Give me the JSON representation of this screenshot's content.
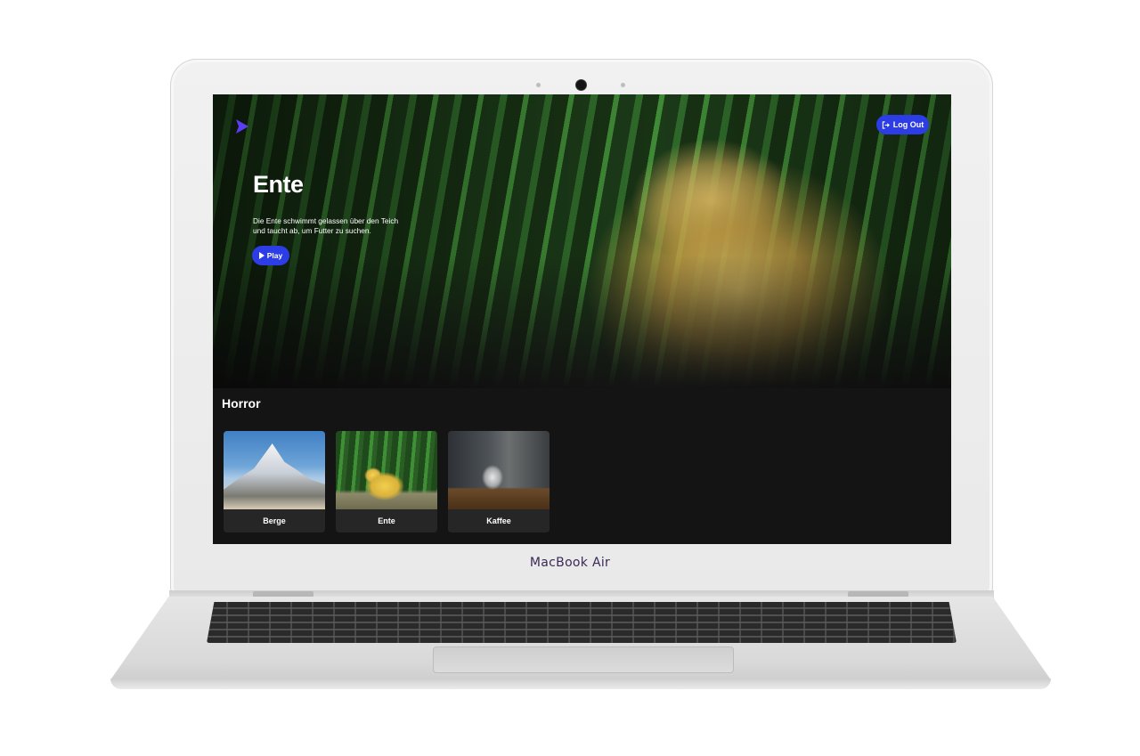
{
  "device": {
    "brand": "MacBook Air"
  },
  "app": {
    "logout_label": "Log Out",
    "hero": {
      "title": "Ente",
      "description": "Die Ente schwimmt gelassen über den Teich und taucht ab, um Futter zu suchen.",
      "play_label": "Play"
    },
    "row": {
      "title": "Horror",
      "cards": [
        {
          "label": "Berge"
        },
        {
          "label": "Ente"
        },
        {
          "label": "Kaffee"
        }
      ]
    }
  },
  "colors": {
    "accent": "#2c3de6",
    "logo": "#5b3df5",
    "background": "#141414",
    "card": "#262626"
  }
}
